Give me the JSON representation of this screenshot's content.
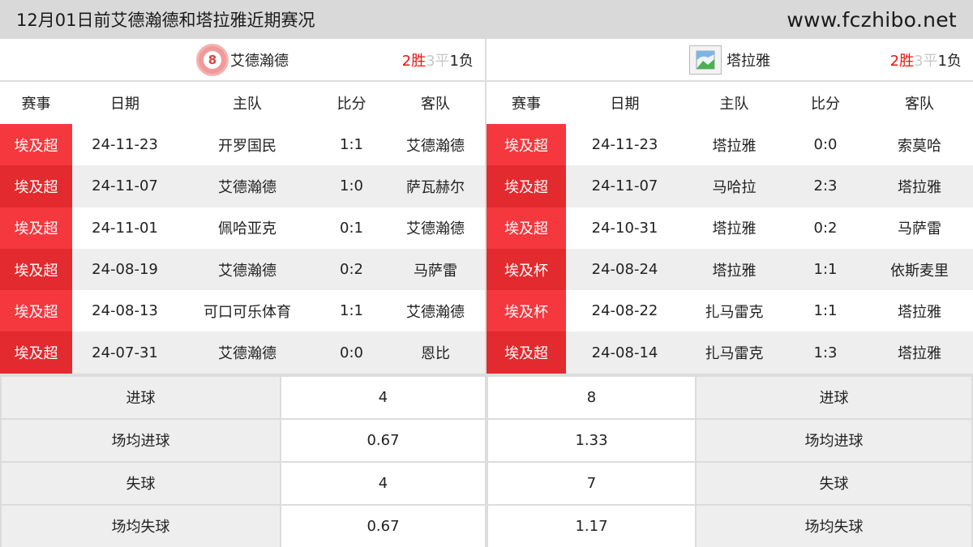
{
  "header": {
    "title": "12月01日前艾德瀚德和塔拉雅近期赛况",
    "site": "www.fczhibo.net"
  },
  "colors": {
    "badge_red": "#f5383e",
    "badge_red_dark": "#e22a2f",
    "win_red": "#ee1111",
    "draw_gray": "#c8c8c8",
    "header_gray": "#d9d9d9"
  },
  "columns": [
    "赛事",
    "日期",
    "主队",
    "比分",
    "客队"
  ],
  "left": {
    "team": "艾德瀚德",
    "logo_icon": "team-crest-icon",
    "logo_text": "8",
    "record": {
      "wins": "2胜",
      "draws": "3平",
      "losses": "1负"
    },
    "matches": [
      {
        "comp": "埃及超",
        "date": "24-11-23",
        "home": "开罗国民",
        "score": "1:1",
        "away": "艾德瀚德"
      },
      {
        "comp": "埃及超",
        "date": "24-11-07",
        "home": "艾德瀚德",
        "score": "1:0",
        "away": "萨瓦赫尔"
      },
      {
        "comp": "埃及超",
        "date": "24-11-01",
        "home": "佩哈亚克",
        "score": "0:1",
        "away": "艾德瀚德"
      },
      {
        "comp": "埃及超",
        "date": "24-08-19",
        "home": "艾德瀚德",
        "score": "0:2",
        "away": "马萨雷"
      },
      {
        "comp": "埃及超",
        "date": "24-08-13",
        "home": "可口可乐体育",
        "score": "1:1",
        "away": "艾德瀚德"
      },
      {
        "comp": "埃及超",
        "date": "24-07-31",
        "home": "艾德瀚德",
        "score": "0:0",
        "away": "恩比"
      }
    ]
  },
  "right": {
    "team": "塔拉雅",
    "logo_icon": "broken-image-icon",
    "record": {
      "wins": "2胜",
      "draws": "3平",
      "losses": "1负"
    },
    "matches": [
      {
        "comp": "埃及超",
        "date": "24-11-23",
        "home": "塔拉雅",
        "score": "0:0",
        "away": "索莫哈"
      },
      {
        "comp": "埃及超",
        "date": "24-11-07",
        "home": "马哈拉",
        "score": "2:3",
        "away": "塔拉雅"
      },
      {
        "comp": "埃及超",
        "date": "24-10-31",
        "home": "塔拉雅",
        "score": "0:2",
        "away": "马萨雷"
      },
      {
        "comp": "埃及杯",
        "date": "24-08-24",
        "home": "塔拉雅",
        "score": "1:1",
        "away": "依斯麦里"
      },
      {
        "comp": "埃及杯",
        "date": "24-08-22",
        "home": "扎马雷克",
        "score": "1:1",
        "away": "塔拉雅"
      },
      {
        "comp": "埃及超",
        "date": "24-08-14",
        "home": "扎马雷克",
        "score": "1:3",
        "away": "塔拉雅"
      }
    ]
  },
  "stats": [
    {
      "label": "进球",
      "left": "4",
      "right": "8"
    },
    {
      "label": "场均进球",
      "left": "0.67",
      "right": "1.33"
    },
    {
      "label": "失球",
      "left": "4",
      "right": "7"
    },
    {
      "label": "场均失球",
      "left": "0.67",
      "right": "1.17"
    }
  ]
}
